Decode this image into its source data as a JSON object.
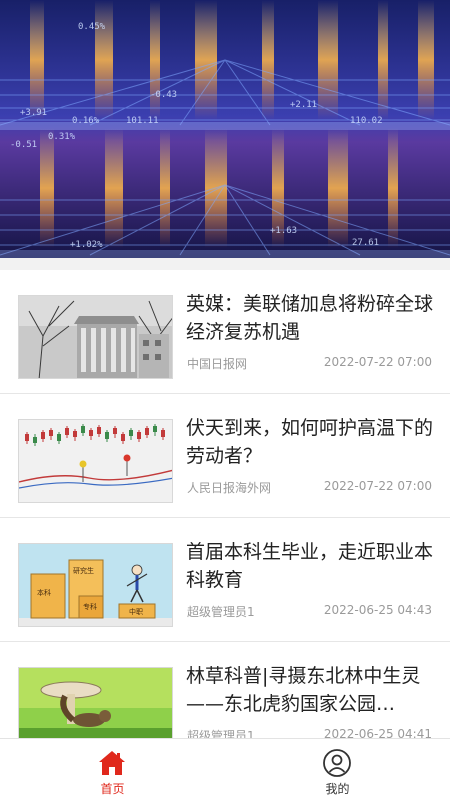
{
  "banner": {
    "ticker_values": [
      "0.45%",
      "-0.43",
      "+3.91",
      "101.11",
      "0.16%",
      "+2.11",
      "+1.02%",
      "-0.51",
      "27.61",
      "110.02",
      "0.31%",
      "+1.63"
    ]
  },
  "news": [
    {
      "title": "英媒：美联储加息将粉碎全球经济复苏机遇",
      "source": "中国日报网",
      "time": "2022-07-22 07:00",
      "thumb_icon": "building-photo"
    },
    {
      "title": "伏天到来，如何呵护高温下的劳动者？",
      "source": "人民日报海外网",
      "time": "2022-07-22 07:00",
      "thumb_icon": "stock-chart-photo"
    },
    {
      "title": "首届本科生毕业，走近职业本科教育",
      "source": "超级管理员1",
      "time": "2022-06-25 04:43",
      "thumb_icon": "education-illustration",
      "thumb_labels": [
        "研究生",
        "本科",
        "专科",
        "中职"
      ]
    },
    {
      "title": "林草科普|寻摄东北林中生灵——东北虎豹国家公园…",
      "source": "超级管理员1",
      "time": "2022-06-25 04:41",
      "thumb_icon": "squirrel-mushroom-photo"
    }
  ],
  "tabbar": {
    "home_label": "首页",
    "mine_label": "我的",
    "active_color": "#e0281c",
    "inactive_color": "#333333"
  }
}
